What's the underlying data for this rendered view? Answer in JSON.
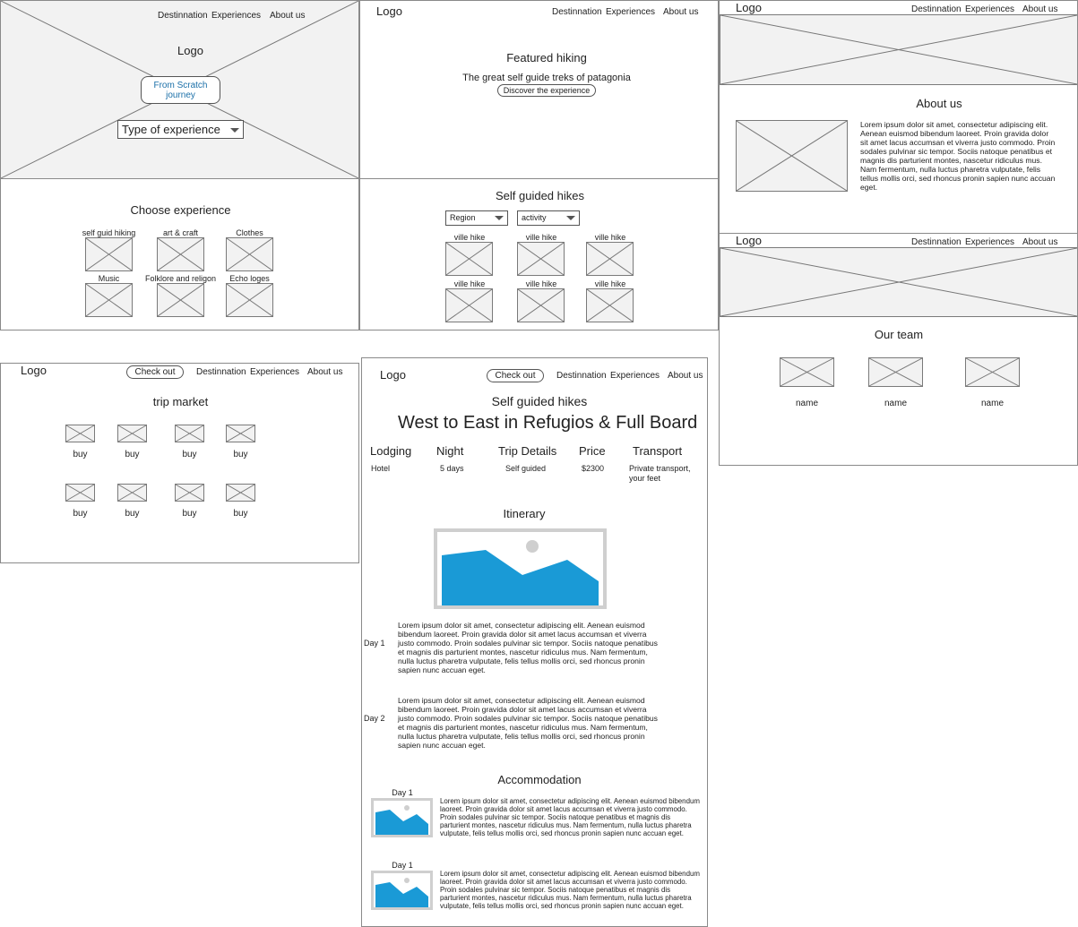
{
  "nav": {
    "logo": "Logo",
    "destination": "Destinnation",
    "experiences": "Experiences",
    "about": "About us",
    "checkout": "Check out"
  },
  "home": {
    "logo": "Logo",
    "cta": "From Scratch journey",
    "select_value": "Type of experience"
  },
  "featured": {
    "title": "Featured hiking",
    "subtitle": "The great self guide treks of patagonia",
    "button": "Discover the experience"
  },
  "about_page": {
    "title": "About us",
    "text": "Lorem ipsum dolor sit amet, consectetur adipiscing elit. Aenean euismod bibendum laoreet. Proin gravida dolor sit amet lacus accumsan et viverra justo commodo. Proin sodales pulvinar sic tempor. Sociis natoque penatibus et magnis dis parturient montes, nascetur ridiculus mus. Nam fermentum, nulla luctus pharetra vulputate, felis tellus mollis orci, sed rhoncus pronin sapien nunc accuan eget."
  },
  "choose": {
    "title": "Choose experience",
    "items": [
      "self guid hiking",
      "art & craft",
      "Clothes",
      "Music",
      "Folklore and religon",
      "Echo loges"
    ]
  },
  "hikes": {
    "title": "Self guided hikes",
    "filter_region": "Region",
    "filter_activity": "activity",
    "items": [
      "ville hike",
      "ville hike",
      "ville hike",
      "ville hike",
      "ville hike",
      "ville hike"
    ]
  },
  "team": {
    "title": "Our team",
    "members": [
      "name",
      "name",
      "name"
    ]
  },
  "market": {
    "title": "trip market",
    "buy_label": "buy"
  },
  "detail": {
    "section": "Self guided hikes",
    "title": "West to East in Refugios & Full Board",
    "headers": [
      "Lodging",
      "Night",
      "Trip Details",
      "Price",
      "Transport"
    ],
    "values": [
      "Hotel",
      "5 days",
      "Self guided",
      "$2300",
      "Private transport, your feet"
    ],
    "itinerary_title": "Itinerary",
    "days": [
      {
        "label": "Day 1",
        "text": "Lorem ipsum dolor sit amet, consectetur adipiscing elit. Aenean euismod bibendum laoreet. Proin gravida dolor sit amet lacus accumsan et viverra justo commodo. Proin sodales pulvinar sic tempor. Sociis natoque penatibus et magnis dis parturient montes, nascetur ridiculus mus. Nam fermentum, nulla luctus pharetra vulputate, felis tellus mollis orci, sed rhoncus pronin sapien nunc accuan eget."
      },
      {
        "label": "Day 2",
        "text": "Lorem ipsum dolor sit amet, consectetur adipiscing elit. Aenean euismod bibendum laoreet. Proin gravida dolor sit amet lacus accumsan et viverra justo commodo. Proin sodales pulvinar sic tempor. Sociis natoque penatibus et magnis dis parturient montes, nascetur ridiculus mus. Nam fermentum, nulla luctus pharetra vulputate, felis tellus mollis orci, sed rhoncus pronin sapien nunc accuan eget."
      }
    ],
    "accommodation_title": "Accommodation",
    "accommodations": [
      {
        "label": "Day 1",
        "text": "Lorem ipsum dolor sit amet, consectetur adipiscing elit. Aenean euismod bibendum laoreet. Proin gravida dolor sit amet lacus accumsan et viverra justo commodo. Proin sodales pulvinar sic tempor. Sociis natoque penatibus et magnis dis parturient montes, nascetur ridiculus mus. Nam fermentum, nulla luctus pharetra vulputate, felis tellus mollis orci, sed rhoncus pronin sapien nunc accuan eget."
      },
      {
        "label": "Day 1",
        "text": "Lorem ipsum dolor sit amet, consectetur adipiscing elit. Aenean euismod bibendum laoreet. Proin gravida dolor sit amet lacus accumsan et viverra justo commodo. Proin sodales pulvinar sic tempor. Sociis natoque penatibus et magnis dis parturient montes, nascetur ridiculus mus. Nam fermentum, nulla luctus pharetra vulputate, felis tellus mollis orci, sed rhoncus pronin sapien nunc accuan eget."
      }
    ]
  },
  "colors": {
    "link_blue": "#1a6fa8",
    "image_blue": "#1a9ad6",
    "placeholder_gray": "#f2f2f2"
  }
}
